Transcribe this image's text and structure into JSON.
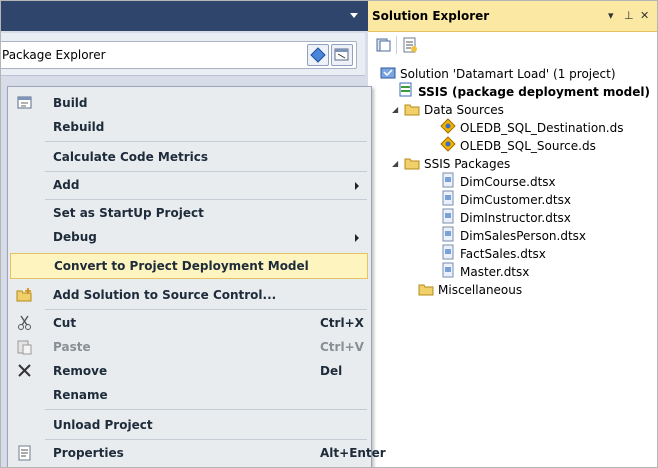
{
  "package_explorer": {
    "label": "Package Explorer"
  },
  "solution_explorer": {
    "title": "Solution Explorer",
    "pin": "▾ ⊥ ✕",
    "tree": {
      "solution": "Solution 'Datamart Load' (1 project)",
      "project": "SSIS (package deployment model)",
      "data_sources_folder": "Data Sources",
      "data_sources": [
        "OLEDB_SQL_Destination.ds",
        "OLEDB_SQL_Source.ds"
      ],
      "packages_folder": "SSIS Packages",
      "packages": [
        "DimCourse.dtsx",
        "DimCustomer.dtsx",
        "DimInstructor.dtsx",
        "DimSalesPerson.dtsx",
        "FactSales.dtsx",
        "Master.dtsx"
      ],
      "misc_folder": "Miscellaneous"
    }
  },
  "context_menu": {
    "items": [
      {
        "label": "Build",
        "icon": "build-icon"
      },
      {
        "label": "Rebuild"
      },
      {
        "label": "Calculate Code Metrics"
      },
      {
        "label": "Add",
        "submenu": true
      },
      {
        "label": "Set as StartUp Project"
      },
      {
        "label": "Debug",
        "submenu": true
      },
      {
        "label": "Convert to Project Deployment Model",
        "highlighted": true
      },
      {
        "label": "Add Solution to Source Control...",
        "icon": "source-control-icon"
      },
      {
        "label": "Cut",
        "shortcut": "Ctrl+X",
        "icon": "cut-icon"
      },
      {
        "label": "Paste",
        "shortcut": "Ctrl+V",
        "icon": "paste-icon",
        "disabled": true
      },
      {
        "label": "Remove",
        "shortcut": "Del",
        "icon": "remove-icon"
      },
      {
        "label": "Rename"
      },
      {
        "label": "Unload Project"
      },
      {
        "label": "Properties",
        "shortcut": "Alt+Enter",
        "icon": "properties-icon"
      }
    ]
  },
  "colors": {
    "header_dark": "#2f456b",
    "se_header": "#fbe9a3",
    "menu_bg": "#e9ecee",
    "highlight": "#fdf4bf"
  }
}
